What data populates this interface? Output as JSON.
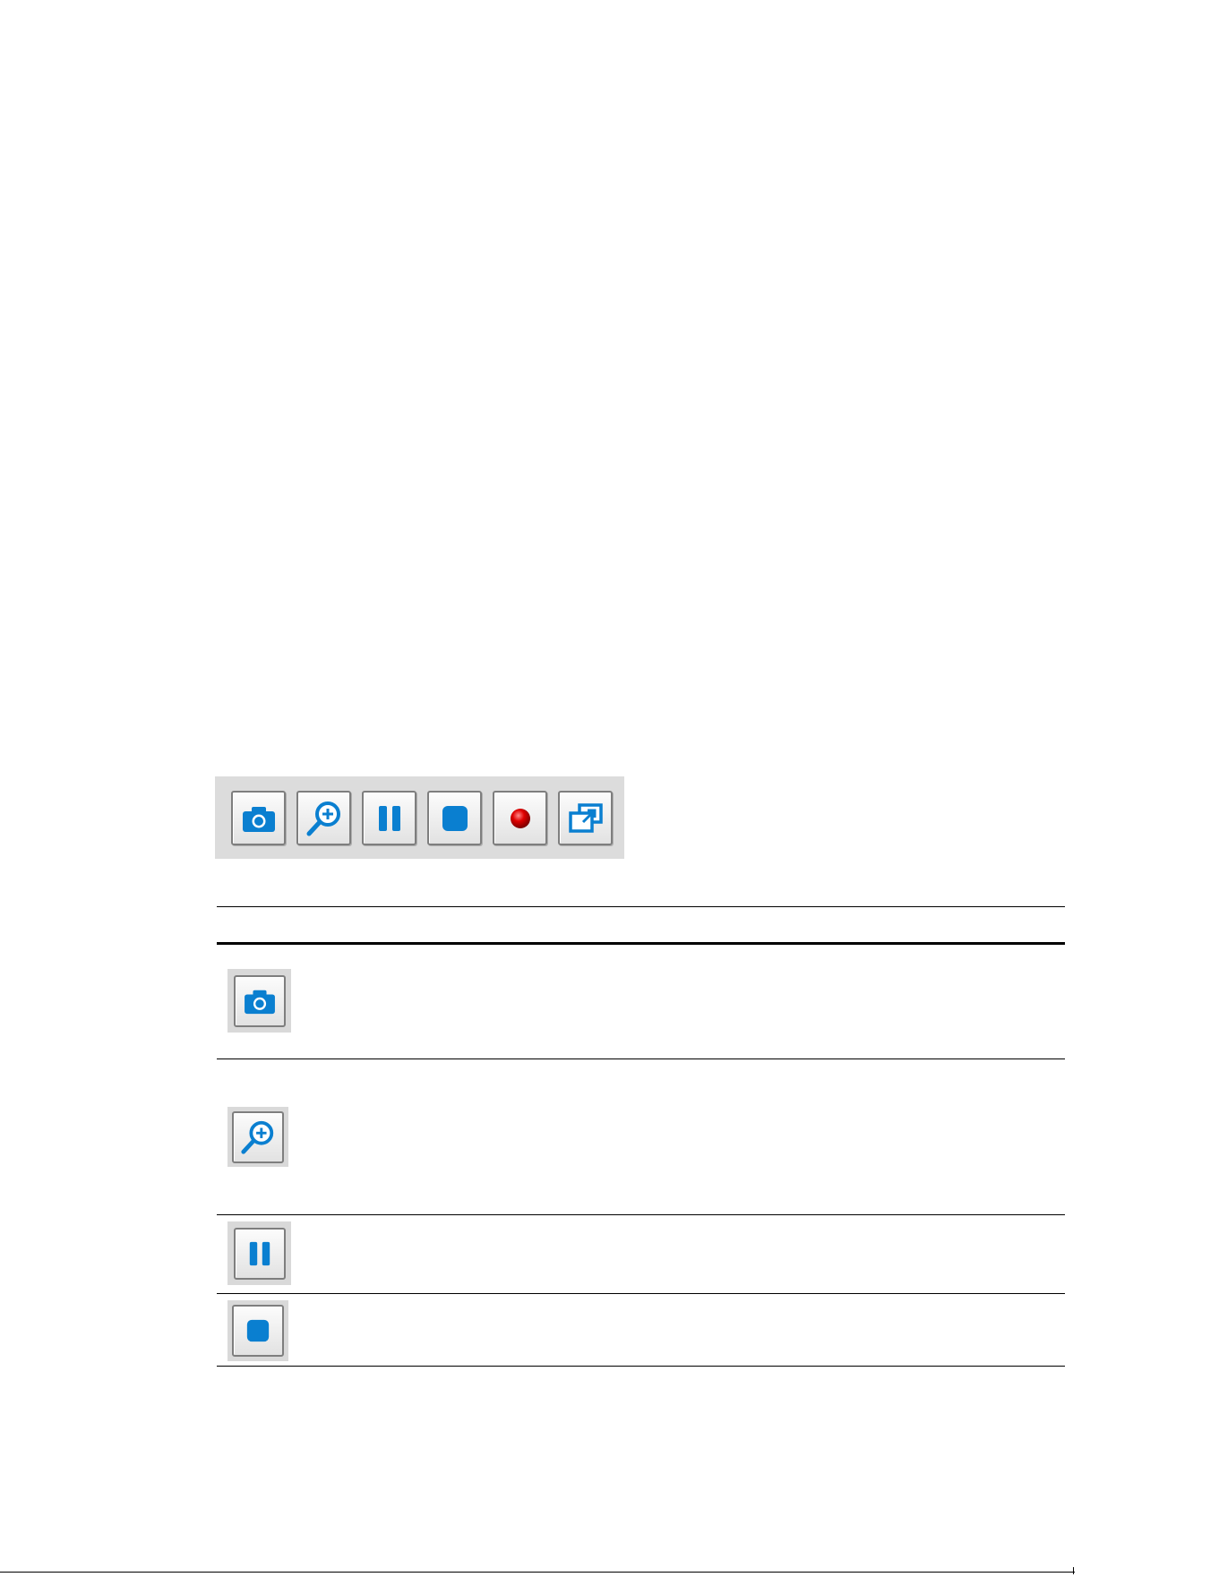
{
  "toolbar": {
    "buttons": [
      {
        "icon": "camera-icon",
        "color": "#0a7fd0"
      },
      {
        "icon": "zoom-in-icon",
        "color": "#0a7fd0"
      },
      {
        "icon": "pause-icon",
        "color": "#0a7fd0"
      },
      {
        "icon": "stop-icon",
        "color": "#0a7fd0"
      },
      {
        "icon": "record-icon",
        "color": "#e00000"
      },
      {
        "icon": "popout-window-icon",
        "color": "#0a7fd0"
      }
    ]
  },
  "table": {
    "rows": [
      {
        "icon": "camera-icon"
      },
      {
        "icon": "zoom-in-icon"
      },
      {
        "icon": "pause-icon"
      },
      {
        "icon": "stop-icon"
      }
    ]
  },
  "colors": {
    "accent_blue": "#0a7fd0",
    "record_red": "#e00000",
    "toolbar_bg": "#dcdcdc"
  }
}
